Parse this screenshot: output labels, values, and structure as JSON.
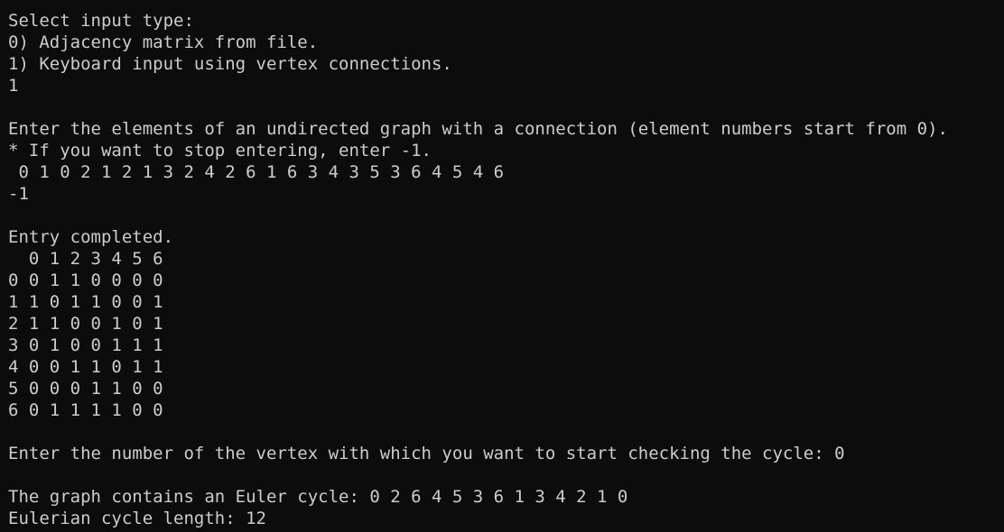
{
  "terminal": {
    "lines": [
      "Select input type:",
      "0) Adjacency matrix from file.",
      "1) Keyboard input using vertex connections.",
      "1",
      "",
      "Enter the elements of an undirected graph with a connection (element numbers start from 0).",
      "* If you want to stop entering, enter -1.",
      " 0 1 0 2 1 2 1 3 2 4 2 6 1 6 3 4 3 5 3 6 4 5 4 6",
      "-1",
      "",
      "Entry completed.",
      "  0 1 2 3 4 5 6",
      "0 0 1 1 0 0 0 0",
      "1 1 0 1 1 0 0 1",
      "2 1 1 0 0 1 0 1",
      "3 0 1 0 0 1 1 1",
      "4 0 0 1 1 0 1 1",
      "5 0 0 0 1 1 0 0",
      "6 0 1 1 1 1 0 0",
      "",
      "Enter the number of the vertex with which you want to start checking the cycle: 0",
      "",
      "The graph contains an Euler cycle: 0 2 6 4 5 3 6 1 3 4 2 1 0",
      "Eulerian cycle length: 12"
    ],
    "background": "#0c0c0c",
    "foreground": "#cccccc"
  }
}
